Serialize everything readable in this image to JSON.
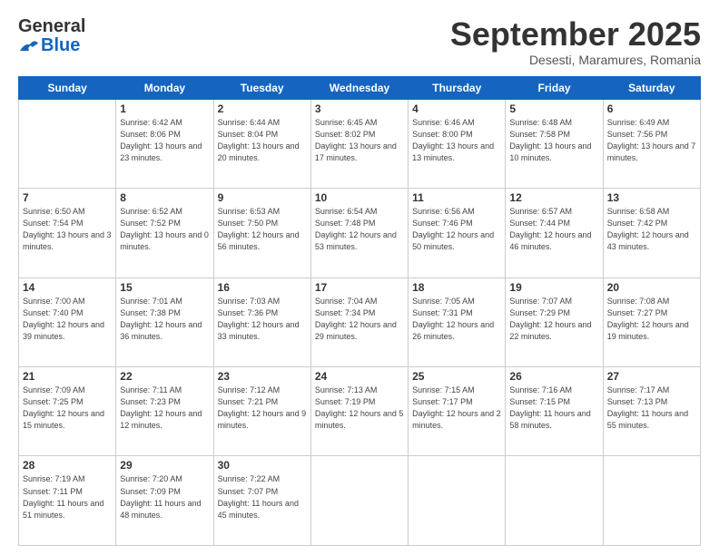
{
  "logo": {
    "general": "General",
    "blue": "Blue"
  },
  "title": "September 2025",
  "location": "Desesti, Maramures, Romania",
  "days_header": [
    "Sunday",
    "Monday",
    "Tuesday",
    "Wednesday",
    "Thursday",
    "Friday",
    "Saturday"
  ],
  "weeks": [
    [
      {
        "day": "",
        "sunrise": "",
        "sunset": "",
        "daylight": ""
      },
      {
        "day": "1",
        "sunrise": "Sunrise: 6:42 AM",
        "sunset": "Sunset: 8:06 PM",
        "daylight": "Daylight: 13 hours and 23 minutes."
      },
      {
        "day": "2",
        "sunrise": "Sunrise: 6:44 AM",
        "sunset": "Sunset: 8:04 PM",
        "daylight": "Daylight: 13 hours and 20 minutes."
      },
      {
        "day": "3",
        "sunrise": "Sunrise: 6:45 AM",
        "sunset": "Sunset: 8:02 PM",
        "daylight": "Daylight: 13 hours and 17 minutes."
      },
      {
        "day": "4",
        "sunrise": "Sunrise: 6:46 AM",
        "sunset": "Sunset: 8:00 PM",
        "daylight": "Daylight: 13 hours and 13 minutes."
      },
      {
        "day": "5",
        "sunrise": "Sunrise: 6:48 AM",
        "sunset": "Sunset: 7:58 PM",
        "daylight": "Daylight: 13 hours and 10 minutes."
      },
      {
        "day": "6",
        "sunrise": "Sunrise: 6:49 AM",
        "sunset": "Sunset: 7:56 PM",
        "daylight": "Daylight: 13 hours and 7 minutes."
      }
    ],
    [
      {
        "day": "7",
        "sunrise": "Sunrise: 6:50 AM",
        "sunset": "Sunset: 7:54 PM",
        "daylight": "Daylight: 13 hours and 3 minutes."
      },
      {
        "day": "8",
        "sunrise": "Sunrise: 6:52 AM",
        "sunset": "Sunset: 7:52 PM",
        "daylight": "Daylight: 13 hours and 0 minutes."
      },
      {
        "day": "9",
        "sunrise": "Sunrise: 6:53 AM",
        "sunset": "Sunset: 7:50 PM",
        "daylight": "Daylight: 12 hours and 56 minutes."
      },
      {
        "day": "10",
        "sunrise": "Sunrise: 6:54 AM",
        "sunset": "Sunset: 7:48 PM",
        "daylight": "Daylight: 12 hours and 53 minutes."
      },
      {
        "day": "11",
        "sunrise": "Sunrise: 6:56 AM",
        "sunset": "Sunset: 7:46 PM",
        "daylight": "Daylight: 12 hours and 50 minutes."
      },
      {
        "day": "12",
        "sunrise": "Sunrise: 6:57 AM",
        "sunset": "Sunset: 7:44 PM",
        "daylight": "Daylight: 12 hours and 46 minutes."
      },
      {
        "day": "13",
        "sunrise": "Sunrise: 6:58 AM",
        "sunset": "Sunset: 7:42 PM",
        "daylight": "Daylight: 12 hours and 43 minutes."
      }
    ],
    [
      {
        "day": "14",
        "sunrise": "Sunrise: 7:00 AM",
        "sunset": "Sunset: 7:40 PM",
        "daylight": "Daylight: 12 hours and 39 minutes."
      },
      {
        "day": "15",
        "sunrise": "Sunrise: 7:01 AM",
        "sunset": "Sunset: 7:38 PM",
        "daylight": "Daylight: 12 hours and 36 minutes."
      },
      {
        "day": "16",
        "sunrise": "Sunrise: 7:03 AM",
        "sunset": "Sunset: 7:36 PM",
        "daylight": "Daylight: 12 hours and 33 minutes."
      },
      {
        "day": "17",
        "sunrise": "Sunrise: 7:04 AM",
        "sunset": "Sunset: 7:34 PM",
        "daylight": "Daylight: 12 hours and 29 minutes."
      },
      {
        "day": "18",
        "sunrise": "Sunrise: 7:05 AM",
        "sunset": "Sunset: 7:31 PM",
        "daylight": "Daylight: 12 hours and 26 minutes."
      },
      {
        "day": "19",
        "sunrise": "Sunrise: 7:07 AM",
        "sunset": "Sunset: 7:29 PM",
        "daylight": "Daylight: 12 hours and 22 minutes."
      },
      {
        "day": "20",
        "sunrise": "Sunrise: 7:08 AM",
        "sunset": "Sunset: 7:27 PM",
        "daylight": "Daylight: 12 hours and 19 minutes."
      }
    ],
    [
      {
        "day": "21",
        "sunrise": "Sunrise: 7:09 AM",
        "sunset": "Sunset: 7:25 PM",
        "daylight": "Daylight: 12 hours and 15 minutes."
      },
      {
        "day": "22",
        "sunrise": "Sunrise: 7:11 AM",
        "sunset": "Sunset: 7:23 PM",
        "daylight": "Daylight: 12 hours and 12 minutes."
      },
      {
        "day": "23",
        "sunrise": "Sunrise: 7:12 AM",
        "sunset": "Sunset: 7:21 PM",
        "daylight": "Daylight: 12 hours and 9 minutes."
      },
      {
        "day": "24",
        "sunrise": "Sunrise: 7:13 AM",
        "sunset": "Sunset: 7:19 PM",
        "daylight": "Daylight: 12 hours and 5 minutes."
      },
      {
        "day": "25",
        "sunrise": "Sunrise: 7:15 AM",
        "sunset": "Sunset: 7:17 PM",
        "daylight": "Daylight: 12 hours and 2 minutes."
      },
      {
        "day": "26",
        "sunrise": "Sunrise: 7:16 AM",
        "sunset": "Sunset: 7:15 PM",
        "daylight": "Daylight: 11 hours and 58 minutes."
      },
      {
        "day": "27",
        "sunrise": "Sunrise: 7:17 AM",
        "sunset": "Sunset: 7:13 PM",
        "daylight": "Daylight: 11 hours and 55 minutes."
      }
    ],
    [
      {
        "day": "28",
        "sunrise": "Sunrise: 7:19 AM",
        "sunset": "Sunset: 7:11 PM",
        "daylight": "Daylight: 11 hours and 51 minutes."
      },
      {
        "day": "29",
        "sunrise": "Sunrise: 7:20 AM",
        "sunset": "Sunset: 7:09 PM",
        "daylight": "Daylight: 11 hours and 48 minutes."
      },
      {
        "day": "30",
        "sunrise": "Sunrise: 7:22 AM",
        "sunset": "Sunset: 7:07 PM",
        "daylight": "Daylight: 11 hours and 45 minutes."
      },
      {
        "day": "",
        "sunrise": "",
        "sunset": "",
        "daylight": ""
      },
      {
        "day": "",
        "sunrise": "",
        "sunset": "",
        "daylight": ""
      },
      {
        "day": "",
        "sunrise": "",
        "sunset": "",
        "daylight": ""
      },
      {
        "day": "",
        "sunrise": "",
        "sunset": "",
        "daylight": ""
      }
    ]
  ]
}
